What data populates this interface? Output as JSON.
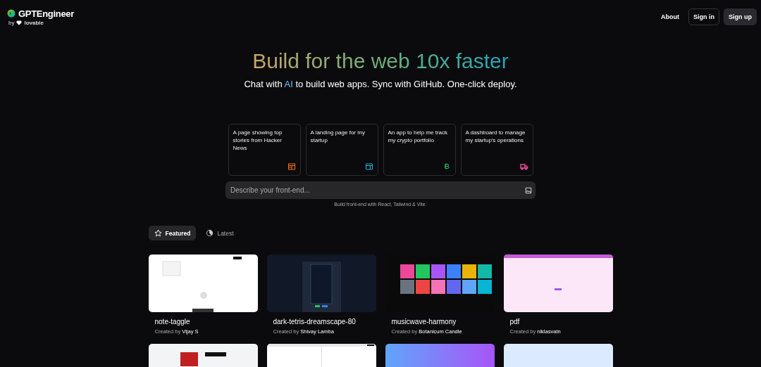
{
  "header": {
    "logo": {
      "name": "GPTEngineer",
      "by": "by",
      "partner": "lovable"
    },
    "nav": [
      {
        "label": "About",
        "kind": "link"
      },
      {
        "label": "Sign in",
        "kind": "outline"
      },
      {
        "label": "Sign up",
        "kind": "filled"
      }
    ]
  },
  "hero": {
    "title": "Build for the web 10x faster",
    "subtitle_before": "Chat with ",
    "subtitle_ai": "AI",
    "subtitle_after": " to build web apps. Sync with GitHub. One-click deploy."
  },
  "suggestions": [
    {
      "text": "A page showing top stories from Hacker News",
      "kind": "layout",
      "color": "#f97316"
    },
    {
      "text": "A landing page for my startup",
      "kind": "browser",
      "color": "#22b8d8"
    },
    {
      "text": "An app to help me track my crypto portfolio",
      "kind": "bitcoin",
      "color": "#22c55e"
    },
    {
      "text": "A dashboard to manage my startup's operations",
      "kind": "truck",
      "color": "#ec4899"
    }
  ],
  "prompt": {
    "placeholder": "Describe your front-end..."
  },
  "caption": "Build front-end with React, Tailwind & Vite.",
  "tabs": [
    {
      "label": "Featured",
      "kind": "star",
      "selected": true
    },
    {
      "label": "Latest",
      "kind": "pie",
      "selected": false
    }
  ],
  "projects": [
    {
      "title": "note-taggle",
      "created_by": "Created by",
      "author": "Vijay S",
      "kind": "notes"
    },
    {
      "title": "dark-tetris-dreamscape-80",
      "created_by": "Created by",
      "author": "Shivay Lamba",
      "kind": "tetris"
    },
    {
      "title": "musicwave-harmony",
      "created_by": "Created by",
      "author": "Botanicum Candle",
      "kind": "music"
    },
    {
      "title": "pdf",
      "created_by": "Created by",
      "author": "niklasvatn",
      "kind": "pink"
    },
    {
      "kind": "palette"
    },
    {
      "kind": "editor"
    },
    {
      "kind": "gradient"
    },
    {
      "kind": "sky"
    }
  ]
}
